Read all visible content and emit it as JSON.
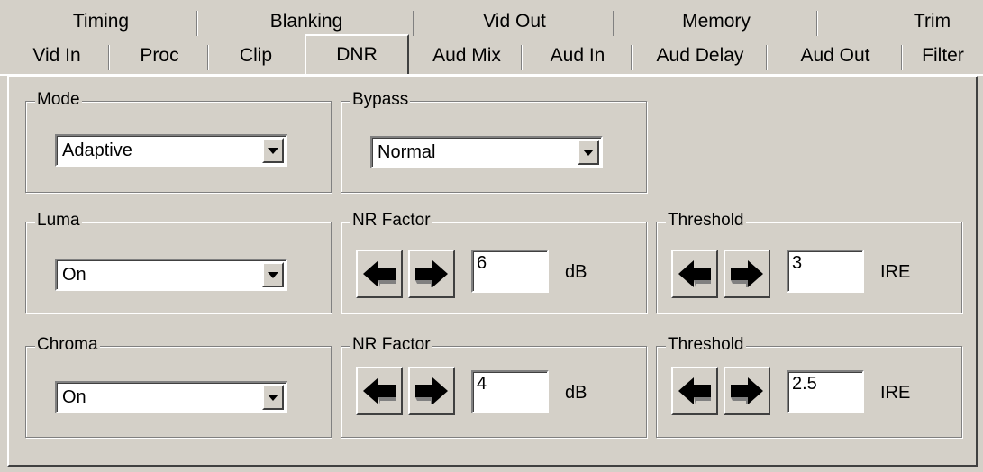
{
  "tabs_back": [
    "Timing",
    "Blanking",
    "Vid Out",
    "Memory",
    "Trim"
  ],
  "tabs_front": [
    "Vid In",
    "Proc",
    "Clip",
    "DNR",
    "Aud Mix",
    "Aud In",
    "Aud Delay",
    "Aud Out",
    "Filter"
  ],
  "active_tab": "DNR",
  "mode": {
    "label": "Mode",
    "value": "Adaptive"
  },
  "bypass": {
    "label": "Bypass",
    "value": "Normal"
  },
  "luma": {
    "label": "Luma",
    "value": "On",
    "nr_factor": {
      "label": "NR Factor",
      "value": "6",
      "unit": "dB"
    },
    "threshold": {
      "label": "Threshold",
      "value": "3",
      "unit": "IRE"
    }
  },
  "chroma": {
    "label": "Chroma",
    "value": "On",
    "nr_factor": {
      "label": "NR Factor",
      "value": "4",
      "unit": "dB"
    },
    "threshold": {
      "label": "Threshold",
      "value": "2.5",
      "unit": "IRE"
    }
  },
  "icons": {
    "left": "left-arrow-icon",
    "right": "right-arrow-icon",
    "dropdown": "chevron-down-icon"
  }
}
